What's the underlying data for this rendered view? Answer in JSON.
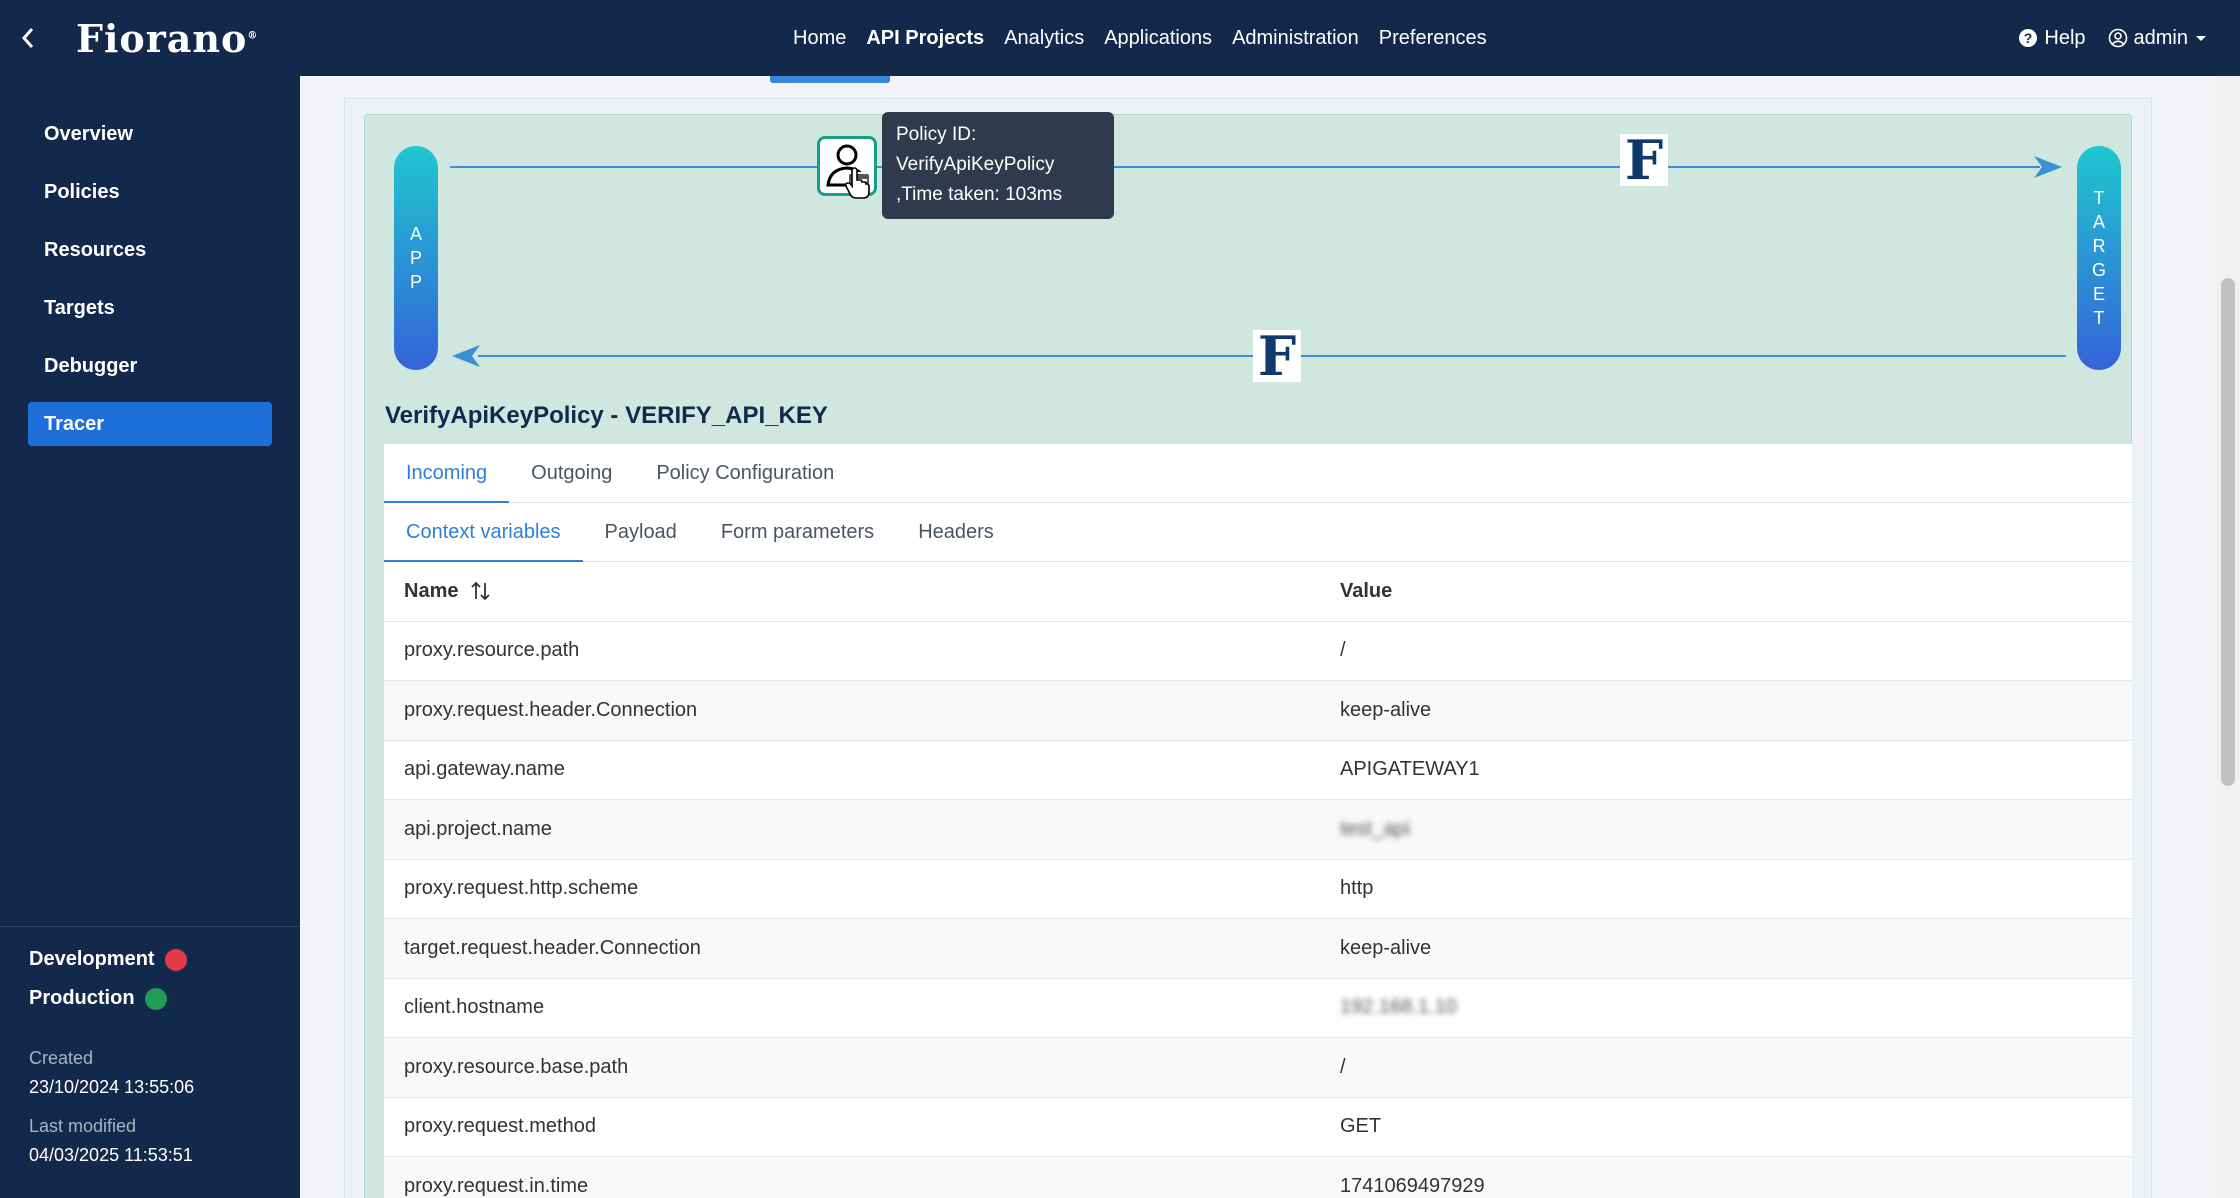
{
  "header": {
    "logo": "Fiorano",
    "nav": [
      "Home",
      "API Projects",
      "Analytics",
      "Applications",
      "Administration",
      "Preferences"
    ],
    "active_nav": "API Projects",
    "help": "Help",
    "user": "admin"
  },
  "sidebar": {
    "items": [
      "Overview",
      "Policies",
      "Resources",
      "Targets",
      "Debugger",
      "Tracer"
    ],
    "active": "Tracer",
    "environments": [
      {
        "name": "Development",
        "status_color": "#e03a45"
      },
      {
        "name": "Production",
        "status_color": "#1f9e55"
      }
    ],
    "created_label": "Created",
    "created_value": "23/10/2024 13:55:06",
    "modified_label": "Last modified",
    "modified_value": "04/03/2025 11:53:51"
  },
  "flow": {
    "app_label": [
      "A",
      "P",
      "P"
    ],
    "target_label": [
      "T",
      "A",
      "R",
      "G",
      "E",
      "T"
    ],
    "f_letter": "F",
    "tooltip": {
      "line1": "Policy ID:",
      "line2": "VerifyApiKeyPolicy",
      "line3": ",Time taken: 103ms"
    }
  },
  "policy_title": "VerifyApiKeyPolicy - VERIFY_API_KEY",
  "tabs": {
    "main": [
      "Incoming",
      "Outgoing",
      "Policy Configuration"
    ],
    "main_active": "Incoming",
    "sub": [
      "Context variables",
      "Payload",
      "Form parameters",
      "Headers"
    ],
    "sub_active": "Context variables"
  },
  "table": {
    "columns": [
      "Name",
      "Value"
    ],
    "rows": [
      {
        "name": "proxy.resource.path",
        "value": "/"
      },
      {
        "name": "proxy.request.header.Connection",
        "value": "keep-alive"
      },
      {
        "name": "api.gateway.name",
        "value": "APIGATEWAY1"
      },
      {
        "name": "api.project.name",
        "value": "test_api",
        "blurred": true
      },
      {
        "name": "proxy.request.http.scheme",
        "value": "http"
      },
      {
        "name": "target.request.header.Connection",
        "value": "keep-alive"
      },
      {
        "name": "client.hostname",
        "value": "192.168.1.10",
        "blurred": true
      },
      {
        "name": "proxy.resource.base.path",
        "value": "/"
      },
      {
        "name": "proxy.request.method",
        "value": "GET"
      },
      {
        "name": "proxy.request.in.time",
        "value": "1741069497929"
      }
    ]
  }
}
